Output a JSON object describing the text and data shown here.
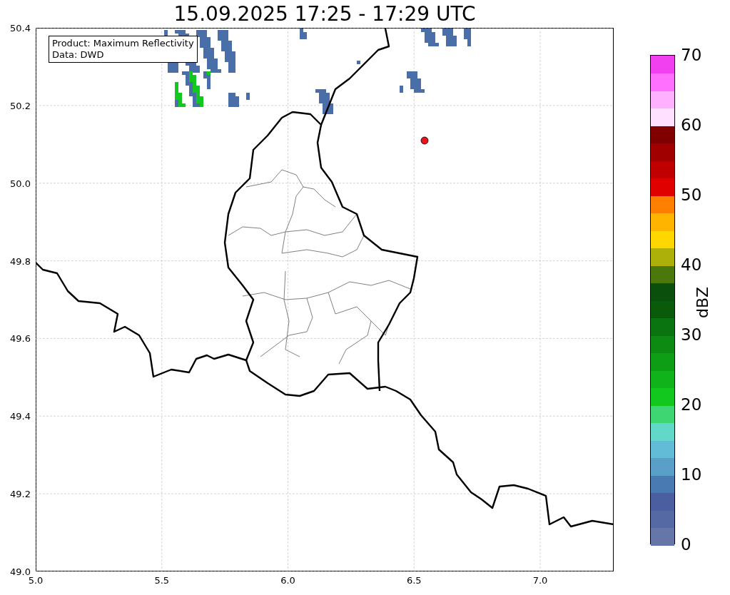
{
  "title": "15.09.2025 17:25 - 17:29 UTC",
  "map": {
    "info_box": [
      "Product: Maximum Reflectivity",
      "Data: DWD"
    ],
    "y_axis": {
      "ticks": [
        "50.4",
        "50.2",
        "50.0",
        "49.8",
        "49.6",
        "49.4",
        "49.2",
        "49.0"
      ]
    },
    "x_axis": {
      "ticks": [
        "5.0",
        "5.5",
        "6.0",
        "6.5",
        "7.0"
      ]
    }
  },
  "colorbar": {
    "label": "dBZ",
    "ticks": [
      "70",
      "60",
      "50",
      "40",
      "30",
      "20",
      "10",
      "0"
    ]
  }
}
